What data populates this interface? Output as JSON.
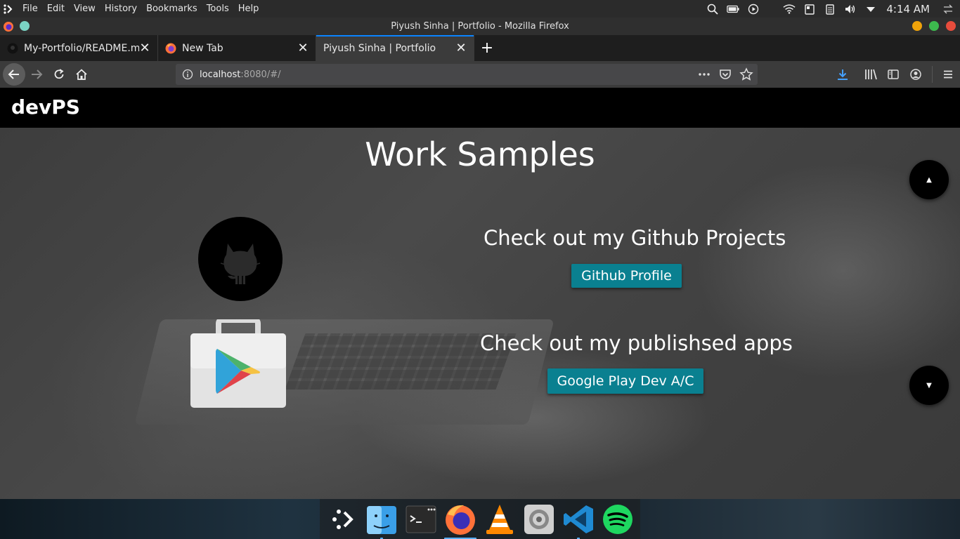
{
  "system_bar": {
    "menu": [
      "File",
      "Edit",
      "View",
      "History",
      "Bookmarks",
      "Tools",
      "Help"
    ],
    "clock": "4:14 AM",
    "tray_icons": [
      "search-icon",
      "battery-icon",
      "media-play-icon",
      "wifi-icon",
      "clipboard-icon",
      "clipboard-list-icon",
      "volume-icon",
      "dropdown-arrow-icon",
      "network-switch-icon"
    ]
  },
  "window": {
    "title": "Piyush Sinha | Portfolio - Mozilla Firefox",
    "controls": {
      "minimize_color": "#f0a30a",
      "maximize_color": "#3dba4e",
      "close_color": "#e74c3c"
    }
  },
  "tabs": [
    {
      "label": "My-Portfolio/README.md",
      "icon": "github-favicon",
      "active": false
    },
    {
      "label": "New Tab",
      "icon": "firefox-favicon",
      "active": false
    },
    {
      "label": "Piyush Sinha | Portfolio",
      "icon": "none",
      "active": true
    }
  ],
  "toolbar": {
    "url_host": "localhost",
    "url_rest": ":8080/#/"
  },
  "page": {
    "brand": "devPS",
    "heading": "Work Samples",
    "sections": [
      {
        "title": "Check out my Github Projects",
        "button": "Github Profile",
        "logo": "github-logo"
      },
      {
        "title": "Check out my publishsed apps",
        "button": "Google Play Dev A/C",
        "logo": "google-play-logo"
      }
    ],
    "accent_color": "#0a8090"
  },
  "dock": [
    "app-launcher",
    "finder",
    "terminal",
    "firefox",
    "vlc",
    "system-settings",
    "vscode",
    "spotify"
  ]
}
